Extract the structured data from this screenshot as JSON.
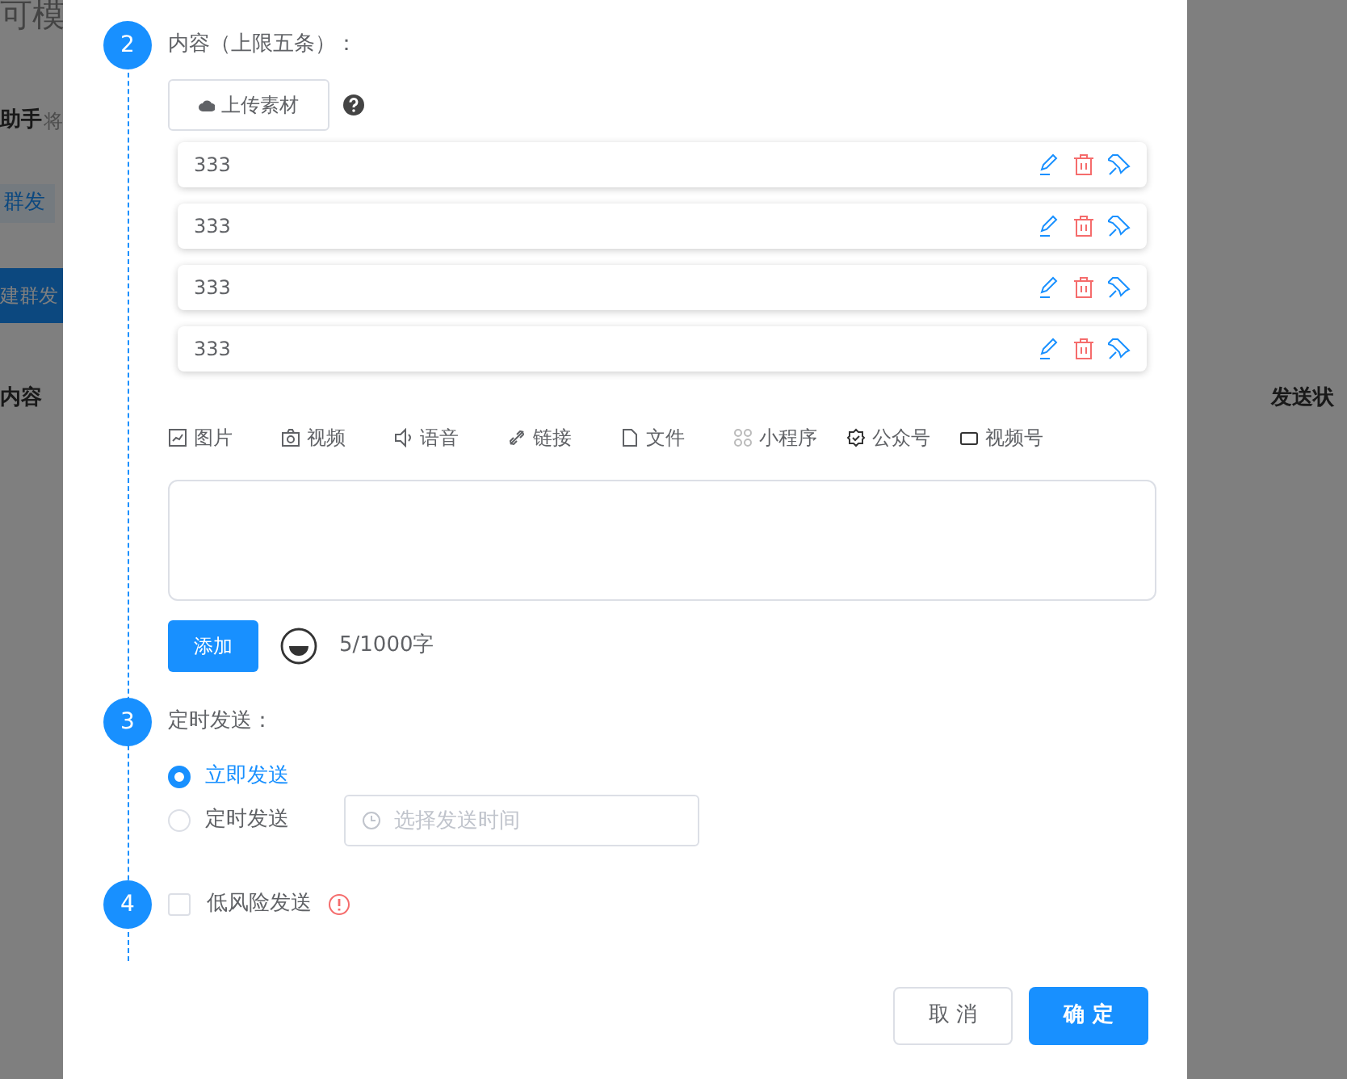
{
  "backdrop": {
    "left": [
      {
        "text": "可模",
        "kind": "title"
      },
      {
        "text": "助手",
        "kind": "bold"
      },
      {
        "text": "将",
        "kind": "muted"
      },
      {
        "text": "群发",
        "kind": "tab"
      },
      {
        "text": "建群发",
        "kind": "button"
      },
      {
        "text": "内容",
        "kind": "bold"
      }
    ],
    "right": [
      {
        "text": "发送状",
        "kind": "bold"
      }
    ]
  },
  "steps": [
    {
      "number": "2",
      "label": "内容（上限五条）：",
      "kind": "content"
    },
    {
      "number": "3",
      "label": "定时发送：",
      "kind": "schedule"
    },
    {
      "number": "4",
      "label": "低风险发送",
      "kind": "risk"
    }
  ],
  "upload_button": "上传素材",
  "items": [
    {
      "text": "333"
    },
    {
      "text": "333"
    },
    {
      "text": "333"
    },
    {
      "text": "333"
    }
  ],
  "media_types": [
    {
      "label": "图片",
      "kind": "image"
    },
    {
      "label": "视频",
      "kind": "camera"
    },
    {
      "label": "语音",
      "kind": "voice"
    },
    {
      "label": "链接",
      "kind": "link"
    },
    {
      "label": "文件",
      "kind": "file"
    },
    {
      "label": "小程序",
      "kind": "grid"
    },
    {
      "label": "公众号",
      "kind": "badge"
    },
    {
      "label": "视频号",
      "kind": "screen"
    }
  ],
  "add_button": "添加",
  "counter": "5/1000字",
  "schedule_options": [
    {
      "label": "立即发送",
      "selected": true
    },
    {
      "label": "定时发送",
      "selected": false
    }
  ],
  "time_field": {
    "placeholder": "选择发送时间"
  },
  "low_risk": {
    "checked": false
  },
  "buttons": [
    {
      "label": "取 消",
      "kind": "default"
    },
    {
      "label": "确 定",
      "kind": "primary"
    }
  ]
}
